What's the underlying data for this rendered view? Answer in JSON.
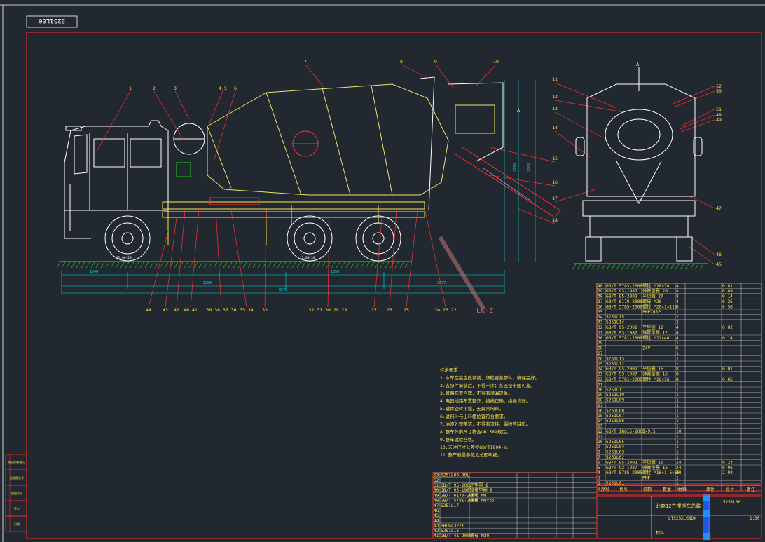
{
  "drawing_number_stamp": "5251L00",
  "colors": {
    "background": "#212830",
    "frame": "#ff2a2a",
    "truck_body": "#ffffff",
    "drum": "#e8e46a",
    "chassis": "#ffe34d",
    "wheel": "#ffffff",
    "dimension": "#00e1e1",
    "leader": "#ff3030",
    "label": "#ffe34d",
    "grid": "#ffffff",
    "ground": "#19c919"
  },
  "view_a_label": "A",
  "view_a_top_label": "A",
  "watermark_text": "LK-Z",
  "callouts_top": [
    "1",
    "2",
    "3",
    "4.5",
    "6",
    "7",
    "8",
    "9",
    "10"
  ],
  "callouts_right": [
    "11",
    "12",
    "13",
    "14",
    "15",
    "16",
    "17",
    "18"
  ],
  "callouts_bottom": [
    "44",
    "43",
    "42",
    "40.41",
    "39.38.37.36",
    "35.34",
    "33",
    "32.31.30.29.28",
    "27",
    "26",
    "25",
    "24.23.22"
  ],
  "rear_callouts_right": [
    "52",
    "50",
    "51",
    "48",
    "49",
    "47",
    "46",
    "45"
  ],
  "dimensions": {
    "d_left": "1640",
    "d_wheelbase1": "3200",
    "d_total": "8570",
    "d_wheelbase2": "1350",
    "d_rear": "2077",
    "d_height": "3860",
    "d_mid": "3990"
  },
  "tire_label": "12.00-20",
  "technical_notes": [
    "技术要求",
    "1.本车在底盘改装前，须检查各部件，确保完好。",
    "2.各部件安装后，不得干涉；各连接牢固可靠。",
    "3.管路布置合理，不得有渗漏现象。",
    "4.电器线路布置整齐，接线正确，绝缘良好。",
    "5.罐体旋转平稳，无异常响声。",
    "6.进料斗与出料槽位置符合要求。",
    "7.油漆外观整洁，不得有流挂、漏喷等缺陷。",
    "8.整车外廓尺寸符合GB1589规定。",
    "9.整车试验合格。",
    "10.未注尺寸公差按GB/T1804-m。",
    "11.整车质量参数见总图明细。"
  ],
  "bom_top": [
    [
      "40",
      "GB/T 5783-2000",
      "螺栓 M20×70",
      "4",
      "",
      "0.81"
    ],
    [
      "39",
      "GB/T 93-1987",
      "弹簧垫圈 20",
      "8",
      "",
      "0.09"
    ],
    [
      "38",
      "GB/T 95-2002",
      "平垫圈 20",
      "8",
      "",
      "0.14"
    ],
    [
      "37",
      "GB/T 6170-2000",
      "螺母 M20",
      "4",
      "",
      "0.25"
    ],
    [
      "36",
      "GB/T 5785-2000",
      "螺栓 M20×1×110",
      "6",
      "",
      "0.56"
    ],
    [
      "35",
      "",
      "PMP76SP",
      "1",
      "",
      ""
    ],
    [
      "34",
      "5251L15",
      "",
      "2",
      "",
      ""
    ],
    [
      "33",
      "5251L14",
      "",
      "2",
      "",
      ""
    ],
    [
      "32",
      "GB/T 95-2002",
      "平垫圈 12",
      "4",
      "",
      "0.02"
    ],
    [
      "31",
      "GB/T 93-1987",
      "弹簧垫圈 12",
      "4",
      "",
      ""
    ],
    [
      "30",
      "GB/T 5781-2000",
      "螺栓 M12×40",
      "4",
      "",
      "0.14"
    ],
    [
      "29",
      "",
      "",
      "1",
      "",
      ""
    ],
    [
      "28",
      "",
      "24V",
      "6",
      "",
      ""
    ],
    [
      "27",
      "",
      "",
      "1",
      "",
      ""
    ],
    [
      "26",
      "5251L13",
      "",
      "1",
      "",
      ""
    ],
    [
      "25",
      "5251L12",
      "",
      "1",
      "",
      ""
    ],
    [
      "24",
      "GB/T 95-2002",
      "平垫圈 16",
      "8",
      "",
      "0.01"
    ],
    [
      "23",
      "GB/T 93-1987",
      "弹簧垫圈 16",
      "8",
      "",
      ""
    ],
    [
      "22",
      "GB/T 5781-2000",
      "螺栓 M16×16",
      "8",
      "",
      "0.05"
    ],
    [
      "21",
      "",
      "",
      "1",
      "",
      ""
    ],
    [
      "20",
      "5251L11",
      "",
      "1",
      "",
      ""
    ],
    [
      "19",
      "5251L10",
      "",
      "1",
      "",
      ""
    ],
    [
      "18",
      "5251L09",
      "",
      "1",
      "",
      ""
    ],
    [
      "17",
      "",
      "",
      "1",
      "",
      ""
    ],
    [
      "16",
      "5251L08",
      "",
      "1",
      "",
      ""
    ],
    [
      "15",
      "5251L07",
      "",
      "1",
      "",
      ""
    ],
    [
      "14",
      "5251L06",
      "",
      "1",
      "",
      ""
    ],
    [
      "13",
      "",
      "",
      "1",
      "",
      ""
    ],
    [
      "12",
      "GB/T 18615-2000",
      "5×9.5",
      "10",
      "",
      ""
    ],
    [
      "11",
      "",
      "",
      "1",
      "",
      ""
    ],
    [
      "10",
      "5251L05",
      "",
      "1",
      "",
      ""
    ],
    [
      "9",
      "5251L04",
      "",
      "1",
      "",
      ""
    ],
    [
      "8",
      "5251L03",
      "",
      "1",
      "",
      ""
    ],
    [
      "7",
      "5251L02",
      "",
      "1",
      "",
      ""
    ],
    [
      "6",
      "GB/T 95-2002",
      "平垫圈 16",
      "24",
      "",
      "0.23"
    ],
    [
      "5",
      "GB/T 93-1987",
      "弹簧垫圈 16",
      "24",
      "",
      "0.06"
    ],
    [
      "4",
      "GB/T 5785-2000",
      "螺栓 M16×1.5×60",
      "24",
      "",
      "2.92"
    ],
    [
      "3",
      "",
      "PMP",
      "1",
      "",
      ""
    ],
    [
      "2",
      "5251L01",
      "",
      "1",
      "",
      ""
    ],
    [
      "1",
      "",
      "",
      "1",
      "",
      ""
    ]
  ],
  "bom_bottom": [
    [
      "53",
      "5251L00.00L",
      ""
    ],
    [
      "52",
      "",
      ""
    ],
    [
      "51",
      "GB/T 95-2002",
      "平垫圈 8"
    ],
    [
      "50",
      "GB/T 93-1987",
      "弹簧垫圈 8"
    ],
    [
      "49",
      "GB/T 6170-2000",
      "螺母 M8"
    ],
    [
      "48",
      "GB/T 5781-2000",
      "螺栓 M8×35"
    ],
    [
      "47",
      "5251L17",
      ""
    ],
    [
      "46",
      "",
      ""
    ],
    [
      "45",
      "",
      ""
    ],
    [
      "44",
      "",
      ""
    ],
    [
      "43",
      "HHD643221",
      ""
    ],
    [
      "42",
      "5251L16",
      ""
    ],
    [
      "41",
      "GB/T 41-2000",
      "螺母 M20"
    ]
  ],
  "bom_header": [
    "序号",
    "代号",
    "名称",
    "数量",
    "材料",
    "单件",
    "总计",
    "备注"
  ],
  "title_block": {
    "title": "北奔12方搅拌车总装",
    "drawing_no": "5251L00",
    "model": "LTS25XLGBDY",
    "scale": "1:30",
    "material_label": "材料"
  },
  "left_revision_labels": [
    "借通用件登记",
    "旧底图总号",
    "底图总号",
    "签字",
    "日期"
  ]
}
